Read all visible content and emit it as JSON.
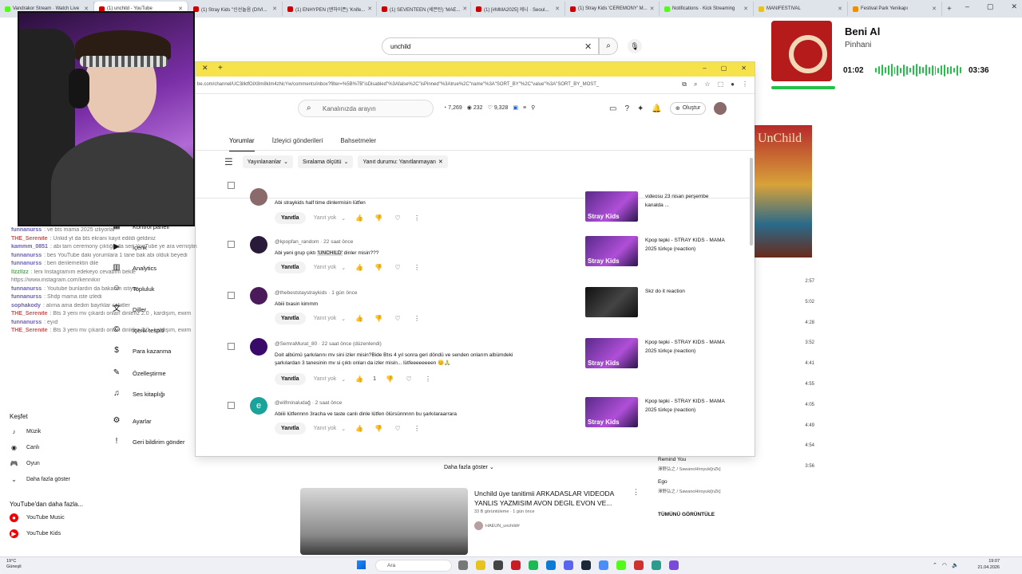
{
  "browser": {
    "tabs": [
      {
        "label": "Vandrakor Stream · Watch Live",
        "fav": "g"
      },
      {
        "label": "(1) unchild - YouTube",
        "fav": "r",
        "active": true
      },
      {
        "label": "(1) Stray Kids \"신선놀음 (DIVI...",
        "fav": "r"
      },
      {
        "label": "(1) ENHYPEN (엔하이픈) 'Knife...",
        "fav": "r"
      },
      {
        "label": "(1) SEVENTEEN (세븐틴) 'MAE...",
        "fav": "r"
      },
      {
        "label": "(1) [#MMA2025] 케니 · Seoul...",
        "fav": "r"
      },
      {
        "label": "(1) Stray Kids 'CEREMONY' M...",
        "fav": "r"
      },
      {
        "label": "Notifications · Kick Streaming",
        "fav": "g"
      },
      {
        "label": "MANIFESTIVAL",
        "fav": "y"
      },
      {
        "label": "Festival Park Yenikapı",
        "fav": "o"
      }
    ]
  },
  "yt": {
    "search_value": "unchild",
    "sidebar": {
      "explore_header": "Keşfet",
      "explore_items": [
        "Müzik",
        "Canlı",
        "Oyun",
        "Daha fazla göster"
      ],
      "more_header": "YouTube'dan daha fazla...",
      "more_items": [
        "YouTube Music",
        "YouTube Kids"
      ]
    },
    "durations": [
      "2:57",
      "5:02",
      "4:28",
      "3:52",
      "4:41",
      "4:55",
      "4:05",
      "4:49",
      "4:54",
      "3:56"
    ],
    "playlist_next": [
      {
        "title": "Remind You",
        "artist": "澤野弘之 / SawanoHiroyuki[nZk]"
      },
      {
        "title": "Ego",
        "artist": "澤野弘之 / SawanoHiroyuki[nZk]"
      }
    ],
    "show_all": "TÜMÜNÜ GÖRÜNTÜLE",
    "album_text": "UnChild",
    "more_button": "Daha fazla göster",
    "bottom_video": {
      "title": "Unchild üye tanitimii ARKADASLAR VIDEODA YANLIS YAZMISIM AVON DEGİL EVON VE...",
      "meta": "33 B görüntüleme · 1 gün önce",
      "channel": "HAEUN_unchild#"
    }
  },
  "menu": {
    "items": [
      {
        "label": "Kontrol paneli",
        "icon": "dashboard-icon"
      },
      {
        "label": "İçerik",
        "icon": "content-icon"
      },
      {
        "label": "Analytics",
        "icon": "analytics-icon"
      },
      {
        "label": "Topluluk",
        "icon": "community-icon"
      },
      {
        "label": "Diller",
        "icon": "languages-icon"
      },
      {
        "label": "İçerik tespiti",
        "icon": "copyright-icon"
      },
      {
        "label": "Para kazanma",
        "icon": "monetization-icon"
      },
      {
        "label": "Özelleştirme",
        "icon": "customization-icon"
      },
      {
        "label": "Ses kitaplığı",
        "icon": "audio-library-icon"
      },
      {
        "label": "Ayarlar",
        "icon": "settings-icon"
      },
      {
        "label": "Geri bildirim gönder",
        "icon": "feedback-icon"
      }
    ]
  },
  "studio": {
    "url": "be.com/channel/UC3ilktfOiX8m8kIm4zNcYw/comments/inbox?filter=%5B%7B\"isDisabled\"%3Afalse%2C\"isPinned\"%3Atrue%2C\"name\"%3A\"SORT_BY\"%2C\"value\"%3A\"SORT_BY_MOST_",
    "search_placeholder": "Kanalınızda arayın",
    "stats": [
      "7,269",
      "232",
      "9,328"
    ],
    "create_label": "Oluştur",
    "tabs": [
      "Yorumlar",
      "İzleyici gönderileri",
      "Bahsetmeler"
    ],
    "filters": [
      "Yayınlananlar",
      "Sıralama ölçütü",
      "Yanıt durumu: Yanıtlanmayan"
    ],
    "reply_label": "Yanıtla",
    "no_reply_label": "Yanıt yok",
    "comments": [
      {
        "author_meta": "",
        "text": "Abi straykids half time dinlermisin lütfen",
        "likes": "",
        "video": "videosu 23 nisan perşembe kanalda ...",
        "thumb_label": "Stray Kids"
      },
      {
        "author_meta": "@kpopfan_random · 22 saat önce",
        "text_before": "Abi yeni grup çıktı ",
        "text_highlight": "'UNCHILD'",
        "text_after": " dinler misin???",
        "likes": "",
        "video": "Kpop tepki - STRAY KIDS - MAMA 2025 türkçe (reaction)",
        "thumb_label": "Stray Kids"
      },
      {
        "author_meta": "@thebeststaystraykids · 1 gün önce",
        "text": "Abiii bıasin kimmm",
        "likes": "",
        "video": "Skz do it reaction",
        "thumb_label": ""
      },
      {
        "author_meta": "@SemraMurat_80 · 22 saat önce (düzenlendi)",
        "text": "Doit albümü şarkılarını mv sini izler misin?Bide Btıs 4 yıl sonra geri döndü ve senden onlarım albümdeki şarkılardan 3 tanesinin mv si çıktı onları da izler misin... lütfeeeeeeeen 😊🙏",
        "likes": "1",
        "video": "Kpop tepki - STRAY KIDS - MAMA 2025 türkçe (reaction)",
        "thumb_label": "Stray Kids"
      },
      {
        "author_meta": "@elifminaludağ · 2 saat önce",
        "text": "Abiiii lütfennnn 3racha ve taste canlı dinle lütfen ölürsünnnnn bu şarkılaraarrara",
        "likes": "",
        "video": "Kpop tepki - STRAY KIDS - MAMA 2025 türkçe (reaction)",
        "thumb_label": "Stray Kids",
        "avatar_letter": "e"
      }
    ]
  },
  "music": {
    "title": "Beni Al",
    "artist": "Pinhani",
    "current": "01:02",
    "duration": "03:36",
    "progress_fraction": 0.287
  },
  "chat": [
    {
      "user": "funnanurss",
      "text": ": ve bts mama 2025 izliyorlar",
      "c": ""
    },
    {
      "user": "THE_Serenite",
      "text": ": Unkid yt da bts ekranı kayıt edildi geldiniz",
      "c": "r"
    },
    {
      "user": "kammm_0851",
      "text": ": abi tam ceremony çıktığında sen YouTube ye ara verniştin",
      "c": ""
    },
    {
      "user": "funnanurss",
      "text": ": bes YouTube daki yorumlara 1 tane bak abi olduk beyedi",
      "c": ""
    },
    {
      "user": "funnanurss",
      "text": ": ben denlemektin dile",
      "c": ""
    },
    {
      "user": "llzzllzz",
      "text": ": leni Instagramım edekeyo cevabını bekle",
      "c": "g"
    },
    {
      "user": "",
      "text": "https://www.instagram.com/kennikxr",
      "c": ""
    },
    {
      "user": "funnanurss",
      "text": ": Youtube bunlardın da bakarım istiyor",
      "c": ""
    },
    {
      "user": "funnanurss",
      "text": ": Shdp mama iste izledi",
      "c": ""
    },
    {
      "user": "sophakody",
      "text": ": alıma ama dedim bayrklar cebitler",
      "c": ""
    },
    {
      "user": "THE_Serenite",
      "text": ": Bts 3 yeni mv çıkardı onları dinleriz 2.0 , kardişım, ewim",
      "c": "r"
    },
    {
      "user": "funnanurss",
      "text": ": eyıd",
      "c": ""
    },
    {
      "user": "THE_Serenite",
      "text": ": Bts 3 yeni mv çıkardı onları dinleriz 2.0 , kardişım, ewim",
      "c": "r"
    }
  ],
  "taskbar": {
    "weather_temp": "19°C",
    "weather_desc": "Güneşli",
    "search_label": "Ara",
    "time": "19:07",
    "date": "21.04.2026"
  }
}
